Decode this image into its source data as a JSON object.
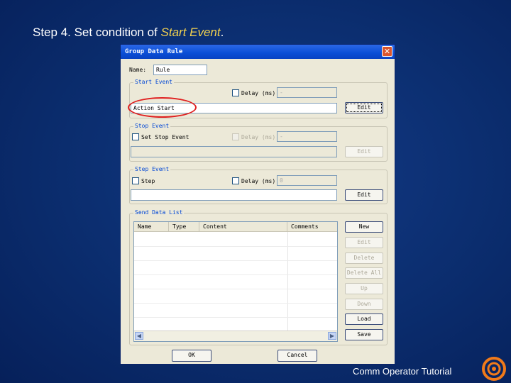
{
  "slide": {
    "title_prefix": "Step 4. Set condition of ",
    "title_accent": "Start Event",
    "title_suffix": ".",
    "footer": "Comm Operator Tutorial",
    "logo_icon": "comm-operator-logo"
  },
  "dialog": {
    "title": "Group Data Rule",
    "close_glyph": "✕",
    "name_label": "Name:",
    "name_value": "Rule",
    "start_event": {
      "title": "Start Event",
      "delay_label": "Delay (ms)",
      "delay_value": "-",
      "condition_value": "Action   Start",
      "edit_label": "Edit"
    },
    "stop_event": {
      "title": "Stop Event",
      "set_stop_label": "Set Stop Event",
      "delay_label": "Delay (ms)",
      "delay_value": "-",
      "condition_value": "",
      "edit_label": "Edit"
    },
    "step_event": {
      "title": "Step Event",
      "step_label": "Step",
      "delay_label": "Delay (ms)",
      "delay_value": "0",
      "condition_value": "",
      "edit_label": "Edit"
    },
    "send_data_list": {
      "title": "Send Data List",
      "columns": [
        "Name",
        "Type",
        "Content",
        "Comments"
      ],
      "buttons": {
        "new": "New",
        "edit": "Edit",
        "delete": "Delete",
        "delete_all": "Delete All",
        "up": "Up",
        "down": "Down",
        "load": "Load",
        "save": "Save"
      }
    },
    "ok_label": "OK",
    "cancel_label": "Cancel"
  },
  "colors": {
    "highlight": "#e02020",
    "accent_text": "#f2d14f",
    "background": "#0b2d6e"
  }
}
